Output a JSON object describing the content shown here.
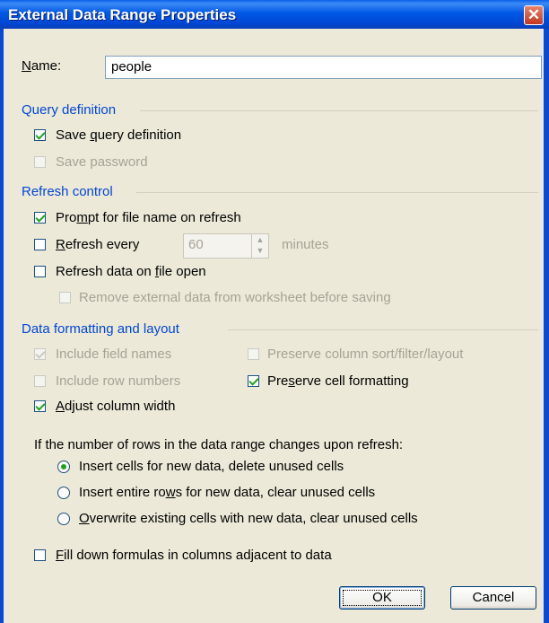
{
  "title": "External Data Range Properties",
  "name_field": {
    "label_pre": "",
    "label_u": "N",
    "label_post": "ame:",
    "value": "people"
  },
  "query_definition": {
    "header": "Query definition",
    "save_query": {
      "pre": "Save ",
      "u": "q",
      "post": "uery definition",
      "checked": true
    },
    "save_password": {
      "label": "Save password",
      "checked": false,
      "disabled": true
    }
  },
  "refresh_control": {
    "header": "Refresh control",
    "prompt": {
      "pre": "Pro",
      "u": "m",
      "post": "pt for file name on refresh",
      "checked": true
    },
    "refresh_every": {
      "pre": "",
      "u": "R",
      "post": "efresh every",
      "value": "60",
      "unit": "minutes",
      "checked": false
    },
    "refresh_open": {
      "pre": "Refresh data on ",
      "u": "f",
      "post": "ile open",
      "checked": false
    },
    "remove_external": {
      "label": "Remove external data from worksheet before saving",
      "checked": false,
      "disabled": true
    }
  },
  "data_formatting": {
    "header": "Data formatting and layout",
    "include_field_names": {
      "label": "Include field names",
      "checked": true,
      "disabled": true
    },
    "include_row_numbers": {
      "label": "Include row numbers",
      "checked": false,
      "disabled": true
    },
    "adjust_width": {
      "pre": "",
      "u": "A",
      "post": "djust column width",
      "checked": true
    },
    "preserve_sort": {
      "label": "Preserve column sort/filter/layout",
      "checked": false,
      "disabled": true
    },
    "preserve_format": {
      "pre": "Pre",
      "u": "s",
      "post": "erve cell formatting",
      "checked": true
    },
    "rows_question": "If the number of rows in the data range changes upon refresh:",
    "options": [
      {
        "label": "Insert cells for new data, delete unused cells",
        "selected": true
      },
      {
        "pre": "Insert entire ro",
        "u": "w",
        "post": "s for new data, clear unused cells",
        "selected": false
      },
      {
        "pre": "",
        "u": "O",
        "post": "verwrite existing cells with new data, clear unused cells",
        "selected": false
      }
    ],
    "fill_down": {
      "pre": "",
      "u": "F",
      "post": "ill down formulas in columns adjacent to data",
      "checked": false
    }
  },
  "buttons": {
    "ok": "OK",
    "cancel": "Cancel"
  }
}
